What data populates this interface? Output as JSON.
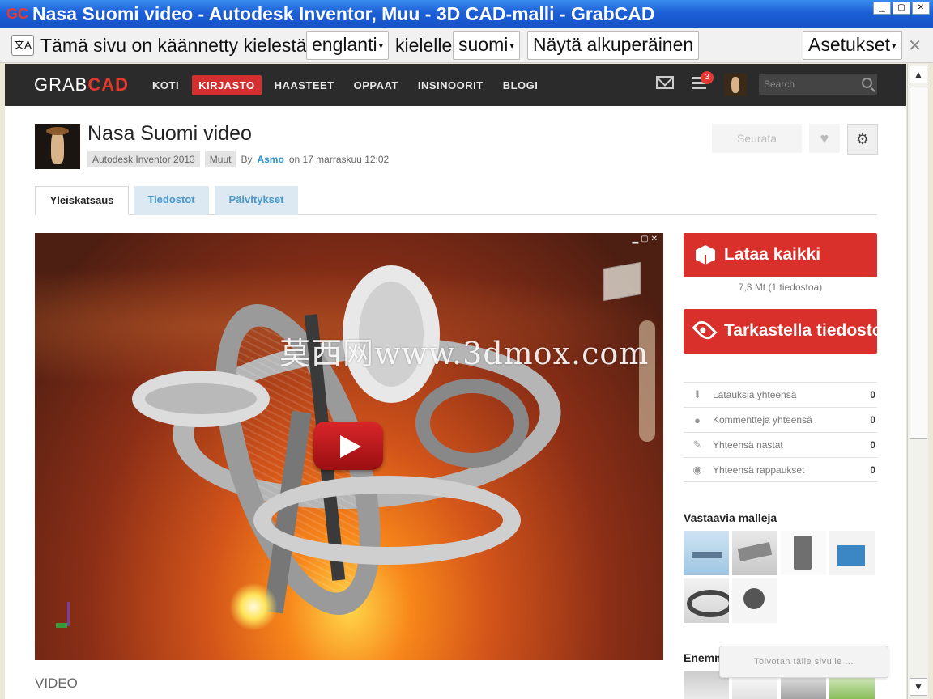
{
  "window": {
    "app_badge": "GC",
    "title": "Nasa Suomi video - Autodesk Inventor, Muu - 3D CAD-malli - GrabCAD"
  },
  "translate_bar": {
    "text_before": "Tämä sivu on käännetty kielestä",
    "from_language": "englanti",
    "text_middle": "kielelle",
    "to_language": "suomi",
    "show_original_label": "Näytä alkuperäinen",
    "settings_label": "Asetukset"
  },
  "nav": {
    "logo_grab": "GRAB",
    "logo_cad": "CAD",
    "links": [
      "KOTI",
      "KIRJASTO",
      "HAASTEET",
      "OPPAAT",
      "INSINOORIT",
      "BLOGI"
    ],
    "active_link": "KIRJASTO",
    "notification_count": "3",
    "search_placeholder": "Search"
  },
  "model": {
    "title": "Nasa Suomi video",
    "software_tag": "Autodesk Inventor 2013",
    "category_tag": "Muut",
    "by_label": "By",
    "author": "Asmo",
    "date": "on 17 marraskuu 12:02",
    "follow_label": "Seurata"
  },
  "tabs": [
    "Yleiskatsaus",
    "Tiedostot",
    "Päivitykset"
  ],
  "video": {
    "watermark": "莫西网www.3dmox.com",
    "label": "VIDEO"
  },
  "sidebar": {
    "download_label": "Lataa kaikki",
    "file_info": "7,3 Mt (1 tiedostoa)",
    "view_label": "Tarkastella tiedostoja",
    "stats": [
      {
        "icon": "download-icon",
        "label": "Latauksia yhteensä",
        "value": "0"
      },
      {
        "icon": "comment-icon",
        "label": "Kommentteja yhteensä",
        "value": "0"
      },
      {
        "icon": "pin-icon",
        "label": "Yhteensä nastat",
        "value": "0"
      },
      {
        "icon": "eye-icon",
        "label": "Yhteensä rappaukset",
        "value": "0"
      }
    ],
    "similar_title": "Vastaavia malleja",
    "more_title": "Enemmän",
    "toast": "Toivotan tälle sivulle ..."
  }
}
